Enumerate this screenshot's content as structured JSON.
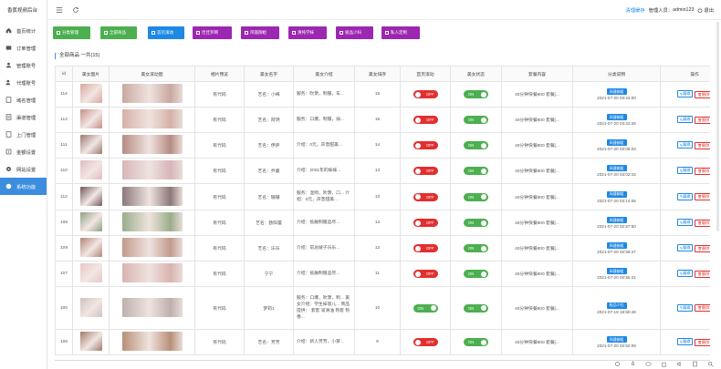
{
  "brand": "香蕉视频后台",
  "sidebar": {
    "items": [
      {
        "label": "首页统计",
        "icon": "home-icon",
        "active": false
      },
      {
        "label": "订单管理",
        "icon": "cart-icon",
        "active": false
      },
      {
        "label": "管理账号",
        "icon": "user-icon",
        "active": false
      },
      {
        "label": "代理账号",
        "icon": "agent-icon",
        "active": false
      },
      {
        "label": "域名管理",
        "icon": "domain-icon",
        "active": false
      },
      {
        "label": "渠道管理",
        "icon": "channel-icon",
        "active": false
      },
      {
        "label": "上门管理",
        "icon": "door-icon",
        "active": false
      },
      {
        "label": "金额设置",
        "icon": "money-icon",
        "active": false
      },
      {
        "label": "网站设置",
        "icon": "gear-icon",
        "active": false
      },
      {
        "label": "系统功能",
        "icon": "system-icon",
        "active": true
      }
    ]
  },
  "topbar": {
    "clear_cache": "清理缓存",
    "admin_prefix": "管理人员：",
    "admin_name": "admin123",
    "logout": "退出"
  },
  "filters": [
    {
      "label": "分类管理",
      "color": "#4caf50"
    },
    {
      "label": "全部商品",
      "color": "#4caf50"
    },
    {
      "label": "首页滚动",
      "color": "#1e88e5"
    },
    {
      "label": "佳佳罗网",
      "color": "#9c27b0"
    },
    {
      "label": "风骚御姐",
      "color": "#9c27b0"
    },
    {
      "label": "清纯学妹",
      "color": "#9c27b0"
    },
    {
      "label": "极品少妇",
      "color": "#9c27b0"
    },
    {
      "label": "私人定制",
      "color": "#9c27b0"
    }
  ],
  "count_title": "全部商品 一共(15)",
  "table": {
    "columns": [
      "id",
      "美女图片",
      "美女滚动图",
      "相片预览",
      "美女名字",
      "美女介绍",
      "美女排序",
      "首页滚动",
      "美女状态",
      "套餐内容",
      "分类说明",
      "操作"
    ],
    "on_label": "ON",
    "off_label": "OFF",
    "edit_label": "编辑",
    "delete_label": "删除",
    "rows": [
      {
        "id": "114",
        "preview": "有代码",
        "name": "艺名：小梅",
        "intro": "服务：吹箫，制服，车...",
        "sort": "15",
        "home": "OFF",
        "status": "ON",
        "pkg": "40分钟快餐800 套餐[...",
        "cat": "风骚御姐",
        "time": "2021-07-20 03:24:00",
        "thumb": "#d9a79c",
        "scene": "#c9a8a0"
      },
      {
        "id": "113",
        "preview": "有代码",
        "name": "艺名：阿玥",
        "intro": "服务：口爆，制服，骑...",
        "sort": "15",
        "home": "OFF",
        "status": "ON",
        "pkg": "40分钟快餐800 套餐[...",
        "cat": "风骚御姐",
        "time": "2021-07-20 03:22:26",
        "thumb": "#c49088",
        "scene": "#d6b1a8"
      },
      {
        "id": "111",
        "preview": "有代码",
        "name": "艺名：伊萨",
        "intro": "介绍：0元，声音甜美...",
        "sort": "14",
        "home": "OFF",
        "status": "ON",
        "pkg": "40分钟快餐800 套餐[...",
        "cat": "风骚御姐",
        "time": "2021-07-20 03:08:03",
        "thumb": "#9a7a70",
        "scene": "#b58c82"
      },
      {
        "id": "110",
        "preview": "有代码",
        "name": "艺名：乔曼",
        "intro": "介绍：2001年的妹妹...",
        "sort": "13",
        "home": "OFF",
        "status": "ON",
        "pkg": "40分钟快餐800 套餐[...",
        "cat": "风骚御姐",
        "time": "2021-07-20 03:02:15",
        "thumb": "#e0bcc0",
        "scene": "#d8b6b8"
      },
      {
        "id": "112",
        "preview": "有代码",
        "name": "艺名：珊珊",
        "intro": "服务：湿吻，吹箫，口... 介绍：0元，声音甜美...",
        "sort": "13",
        "home": "OFF",
        "status": "ON",
        "pkg": "40分钟快餐800 套餐[...",
        "cat": "风骚御姐",
        "time": "2021-07-20 03:14:06",
        "thumb": "#6f5a5a",
        "scene": "#8c7878"
      },
      {
        "id": "108",
        "preview": "有代码",
        "name": "艺名：欧阳蕾",
        "intro": "介绍：抵触制服品尽...",
        "sort": "12",
        "home": "OFF",
        "status": "ON",
        "pkg": "40分钟快餐800 套餐[...",
        "cat": "风骚御姐",
        "time": "2021-07-20 02:57:50",
        "thumb": "#8fa082",
        "scene": "#9aad8a"
      },
      {
        "id": "109",
        "preview": "有代码",
        "name": "艺名：乐乐",
        "intro": "介绍：前总嫂子乐乐...",
        "sort": "12",
        "home": "OFF",
        "status": "ON",
        "pkg": "40分钟快餐800 套餐[...",
        "cat": "风骚御姐",
        "time": "2021-07-20 02:59:47",
        "thumb": "#b08676",
        "scene": "#c29a8c"
      },
      {
        "id": "107",
        "preview": "有代码",
        "name": "宁宁",
        "intro": "介绍：抵触制服品尽...",
        "sort": "11",
        "home": "OFF",
        "status": "ON",
        "pkg": "40分钟快餐800 套餐[...",
        "cat": "风骚御姐",
        "time": "2021-07-20 02:55:41",
        "thumb": "#e7c8c6",
        "scene": "#d9b3b0"
      },
      {
        "id": "100",
        "preview": "有代码",
        "name": "梦莉1",
        "intro": "服务：口爆，吹箫，制... 美女介绍：学生妹思儿... 商品提供： 套套 润滑油 熟套 熟香...",
        "sort": "10",
        "home": "ON",
        "status": "ON",
        "pkg": "40分钟快餐800 套餐[...",
        "cat": "极品少妇",
        "time": "2021-07-19 19:50:48",
        "thumb": "#cfc3c0",
        "scene": "#bdb0ad"
      },
      {
        "id": "106",
        "preview": "有代码",
        "name": "艺名：芳芳",
        "intro": "介绍：新人芳芳，小萝...",
        "sort": "9",
        "home": "OFF",
        "status": "ON",
        "pkg": "40分钟快餐800 套餐[...",
        "cat": "风骚御姐",
        "time": "2021-07-20 02:52:09",
        "thumb": "#a07a68",
        "scene": "#b89078"
      }
    ]
  }
}
